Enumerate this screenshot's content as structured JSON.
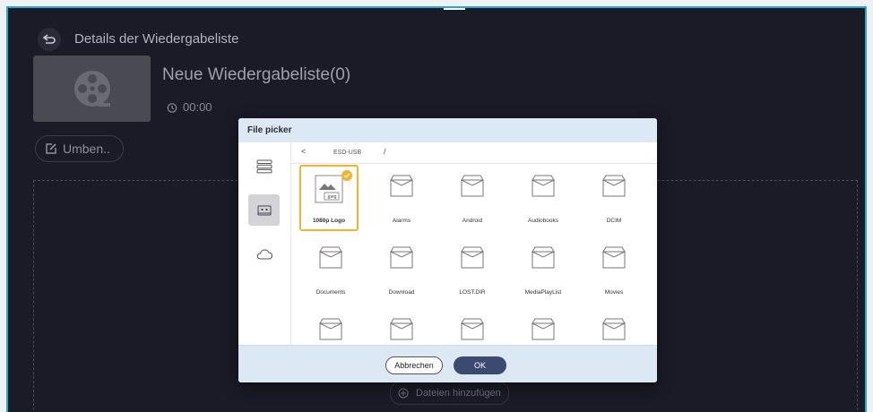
{
  "header": {
    "title": "Details der Wiedergabeliste"
  },
  "playlist": {
    "name": "Neue Wiedergabeliste(0)",
    "duration": "00:00"
  },
  "rename_button": "Umben..",
  "dropzone": {
    "add_files_label": "Dateien hinzufügen"
  },
  "dialog": {
    "title": "File picker",
    "path": {
      "back": "<",
      "device": "ESD-USB",
      "separator": "/"
    },
    "sources": [
      {
        "icon": "list-icon",
        "active": false
      },
      {
        "icon": "usb-drive-icon",
        "active": true
      },
      {
        "icon": "cloud-icon",
        "active": false
      }
    ],
    "items": [
      {
        "label": "1080p Logo",
        "type": "image",
        "badge": ".jpeg",
        "selected": true
      },
      {
        "label": "Alarms",
        "type": "folder"
      },
      {
        "label": "Android",
        "type": "folder"
      },
      {
        "label": "Audiobooks",
        "type": "folder"
      },
      {
        "label": "DCIM",
        "type": "folder"
      },
      {
        "label": "Documents",
        "type": "folder"
      },
      {
        "label": "Download",
        "type": "folder"
      },
      {
        "label": "LOST.DIR",
        "type": "folder"
      },
      {
        "label": "MediaPlayList",
        "type": "folder"
      },
      {
        "label": "Movies",
        "type": "folder"
      },
      {
        "label": "",
        "type": "folder"
      },
      {
        "label": "",
        "type": "folder"
      },
      {
        "label": "",
        "type": "folder"
      },
      {
        "label": "",
        "type": "folder"
      },
      {
        "label": "",
        "type": "folder"
      }
    ],
    "cancel_label": "Abbrechen",
    "ok_label": "OK"
  },
  "colors": {
    "frame_border": "#27a6d8",
    "background": "#1b1b28",
    "selection": "#f2b331",
    "ok_button": "#3b4a6e",
    "dialog_header": "#dde8f5"
  }
}
